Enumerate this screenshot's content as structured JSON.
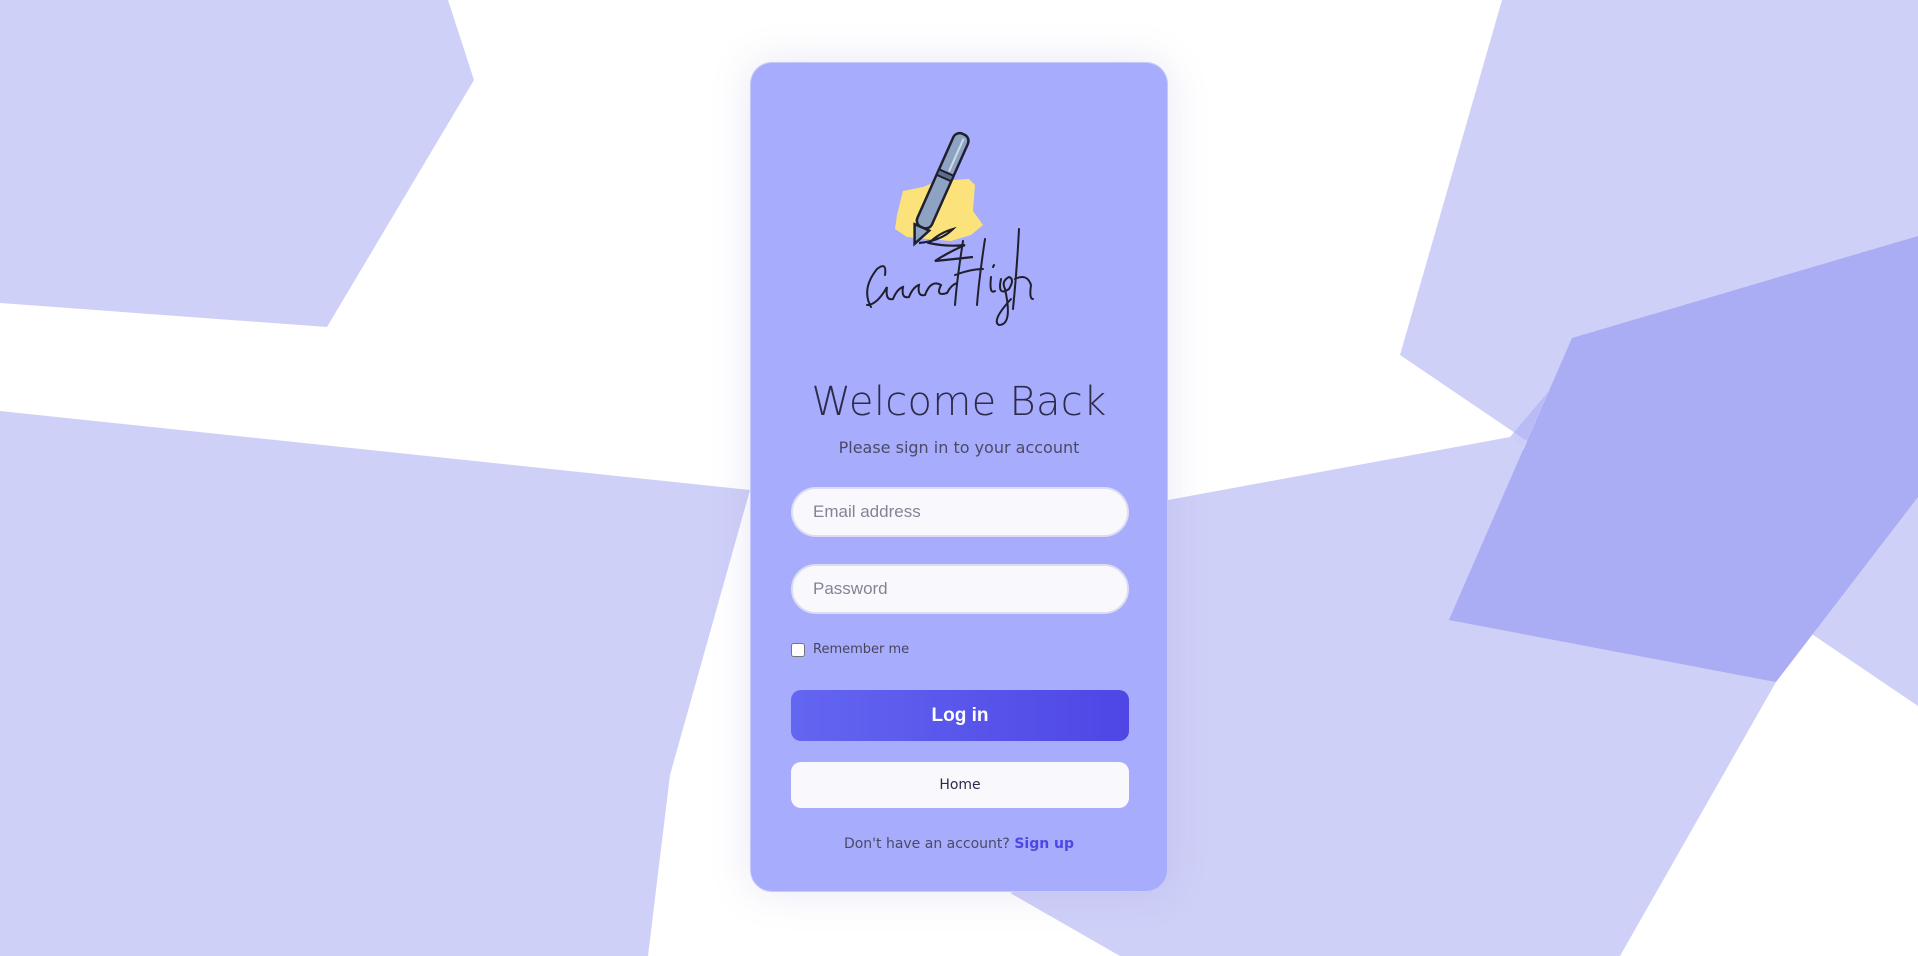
{
  "logo": {
    "text": "CarrerHigh",
    "icon": "pen-signature-logo"
  },
  "header": {
    "title": "Welcome Back",
    "subtitle": "Please sign in to your account"
  },
  "form": {
    "email": {
      "placeholder": "Email address",
      "value": ""
    },
    "password": {
      "placeholder": "Password",
      "value": ""
    },
    "remember_label": "Remember me",
    "remember_checked": false,
    "login_label": "Log in",
    "home_label": "Home"
  },
  "footer": {
    "prompt": "Don't have an account?",
    "signup_label": "Sign up"
  },
  "colors": {
    "card": "#a8acfc",
    "background_shapes": "#cfd0f8",
    "accent": "#4f46e5",
    "logo_highlight": "#fbe27a"
  }
}
